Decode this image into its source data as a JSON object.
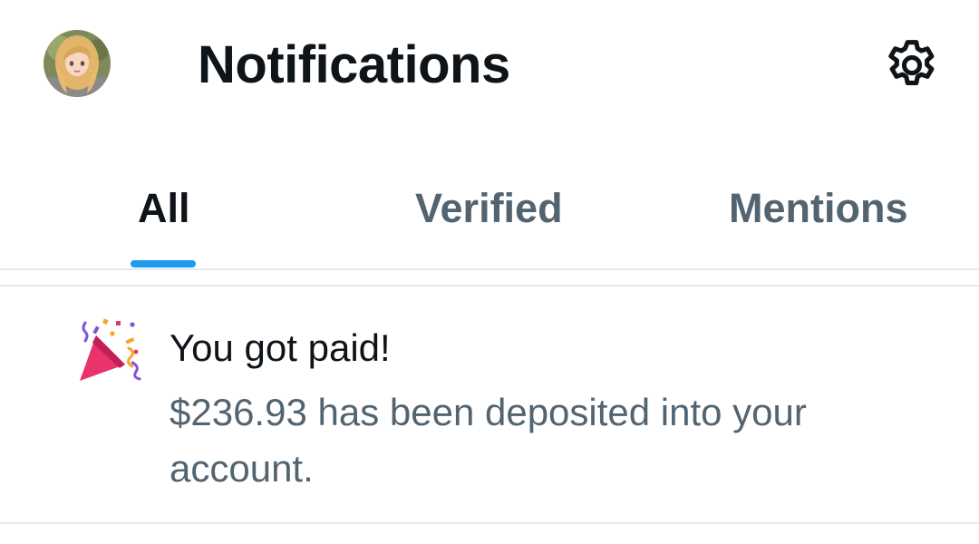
{
  "header": {
    "title": "Notifications",
    "avatar_icon": "user-avatar",
    "settings_icon": "gear-icon"
  },
  "tabs": [
    {
      "label": "All",
      "active": true
    },
    {
      "label": "Verified",
      "active": false
    },
    {
      "label": "Mentions",
      "active": false
    }
  ],
  "notification": {
    "icon": "party-popper-icon",
    "title": "You got paid!",
    "body": "$236.93 has been deposited into your account."
  },
  "colors": {
    "text_primary": "#0f1419",
    "text_secondary": "#536471",
    "accent": "#1d9bf0",
    "divider": "#e3e9ee"
  }
}
